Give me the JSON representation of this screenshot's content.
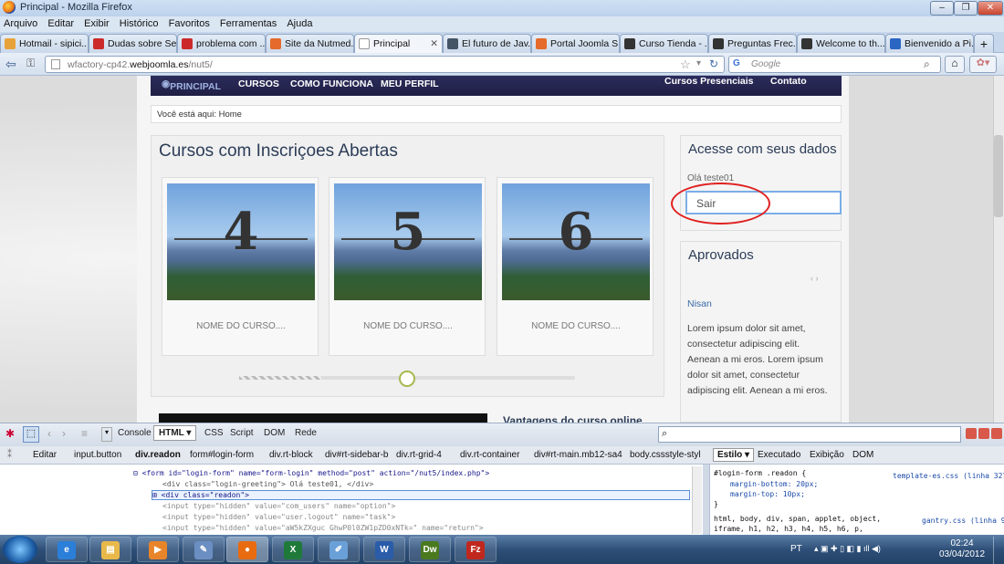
{
  "window": {
    "title": "Principal - Mozilla Firefox",
    "buttons": [
      "–",
      "❐",
      "✕"
    ]
  },
  "menu": [
    "Arquivo",
    "Editar",
    "Exibir",
    "Histórico",
    "Favoritos",
    "Ferramentas",
    "Ajuda"
  ],
  "tabs": [
    {
      "label": "Hotmail - sipici...",
      "color": "#e8a23a",
      "close": ""
    },
    {
      "label": "Dudas sobre Se...",
      "color": "#cc2a2a",
      "close": ""
    },
    {
      "label": "problema com ...",
      "color": "#cc2a2a",
      "close": ""
    },
    {
      "label": "Site da Nutmed...",
      "color": "#e56a2b",
      "close": ""
    },
    {
      "label": "Principal",
      "color": "#f5f5f5",
      "close": "✕"
    },
    {
      "label": "El futuro de Jav...",
      "color": "#445566",
      "close": ""
    },
    {
      "label": "Portal Joomla S...",
      "color": "#e56a2b",
      "close": ""
    },
    {
      "label": "Curso Tienda - ...",
      "color": "#333333",
      "close": ""
    },
    {
      "label": "Preguntas Frec...",
      "color": "#333333",
      "close": ""
    },
    {
      "label": "Welcome to th...",
      "color": "#333333",
      "close": ""
    },
    {
      "label": "Bienvenido a Pi...",
      "color": "#2a66c2",
      "close": ""
    }
  ],
  "new_tab": "+",
  "nav": {
    "url_prefix": "wfactory-cp42.",
    "url_domain": "webjoomla.es",
    "url_path": "/nut5/",
    "search_placeholder": "Google",
    "search_engine_icon": "G"
  },
  "site": {
    "menu": [
      "PRINCIPAL",
      "CURSOS",
      "COMO FUNCIONA",
      "MEU PERFIL"
    ],
    "menu_right": [
      "Cursos Presenciais",
      "Contato"
    ],
    "breadcrumb": "Você está aqui: Home",
    "main_title": "Cursos com Inscriçoes Abertas",
    "cards": [
      {
        "number": "4",
        "name": "NOME DO CURSO...."
      },
      {
        "number": "5",
        "name": "NOME DO CURSO...."
      },
      {
        "number": "6",
        "name": "NOME DO CURSO...."
      }
    ],
    "login_title": "Acesse com seus dados",
    "greeting": "Olá teste01",
    "logout_button": "Sair",
    "approved_title": "Aprovados",
    "approved_name": "Nisan",
    "lorem": "Lorem ipsum dolor sit amet, consectetur adipiscing elit. Aenean a mi eros. Lorem ipsum dolor sit amet, consectetur adipiscing elit. Aenean a mi eros.",
    "bottom_heading": "Vantagens do curso online"
  },
  "firebug": {
    "tabs": [
      "Console",
      "HTML ▾",
      "CSS",
      "Script",
      "DOM",
      "Rede"
    ],
    "edit_label": "Editar",
    "path": [
      "input.button",
      "div.readon",
      "form#login-form",
      "div.rt-block",
      "div#rt-sidebar-b",
      "div.rt-grid-4",
      "div.rt-container",
      "div#rt-main.mb12-sa4",
      "body.cssstyle-styl"
    ],
    "right_tabs": [
      "Estilo ▾",
      "Executado",
      "Exibição",
      "DOM"
    ],
    "html_lines": [
      "<form id=\"login-form\" name=\"form-login\" method=\"post\" action=\"/nut5/index.php\">",
      "<div class=\"login-greeting\"> Olá teste01,  </div>",
      "<div class=\"readon\">",
      "<input type=\"hidden\" value=\"com_users\" name=\"option\">",
      "<input type=\"hidden\" value=\"user.logout\" name=\"task\">",
      "<input type=\"hidden\" value=\"aW5kZXguc GhwP0l0ZW1pZD0xNTk=\" name=\"return\">"
    ],
    "css_lines": [
      "#login-form .readon {",
      "margin-bottom: 20px;",
      "margin-top: 10px;",
      "}",
      "html, body, div, span, applet, object,",
      "iframe, h1, h2, h3, h4, h5, h6, p,"
    ],
    "css_sources": [
      "template-es.css (linha 327)",
      "gantry.css (linha 9)"
    ]
  },
  "taskbar": {
    "apps": [
      {
        "name": "ie",
        "glyph": "e",
        "color": "#2b7fd8"
      },
      {
        "name": "explorer",
        "glyph": "▤",
        "color": "#e8b94a"
      },
      {
        "name": "media",
        "glyph": "▶",
        "color": "#e8842a"
      },
      {
        "name": "tool",
        "glyph": "✎",
        "color": "#6b8fc2"
      },
      {
        "name": "firefox",
        "glyph": "●",
        "color": "#e86b10"
      },
      {
        "name": "excel",
        "glyph": "X",
        "color": "#1f7a3a"
      },
      {
        "name": "notes",
        "glyph": "✐",
        "color": "#6aa0d8"
      },
      {
        "name": "word",
        "glyph": "W",
        "color": "#2a5caa"
      },
      {
        "name": "dreamweaver",
        "glyph": "Dw",
        "color": "#4a7a1e"
      },
      {
        "name": "filezilla",
        "glyph": "Fz",
        "color": "#c0281e"
      }
    ],
    "lang": "PT",
    "time": "02:24",
    "date": "03/04/2012"
  }
}
